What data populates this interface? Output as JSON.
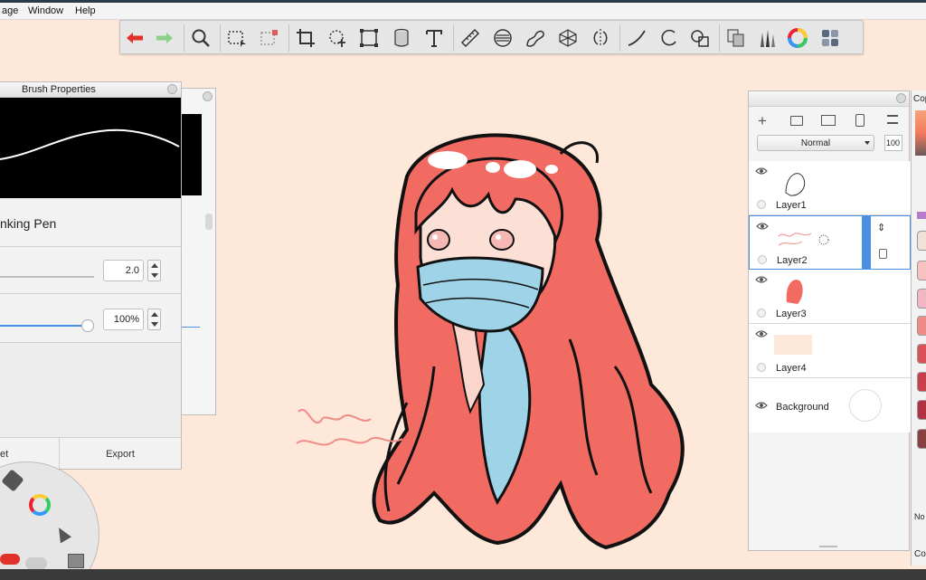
{
  "menu": {
    "items": [
      "age",
      "Window",
      "Help"
    ]
  },
  "toolbar": {
    "tools": [
      "undo-arrow-icon",
      "redo-arrow-icon",
      "magnify-icon",
      "marquee-select-icon",
      "lasso-select-icon",
      "crop-icon",
      "transform-icon",
      "perspective-icon",
      "fill-bucket-icon",
      "text-icon",
      "ruler-icon",
      "ellipse-guide-icon",
      "french-curve-icon",
      "perspective-grid-icon",
      "symmetry-icon",
      "stroke-line-icon",
      "ellipse-icon",
      "shape-icon",
      "layer-copy-icon",
      "brush-library-icon",
      "color-wheel-icon",
      "swatches-icon"
    ]
  },
  "brush_panel": {
    "title": "Brush Properties",
    "brush_name": "nking Pen",
    "size_value": "2.0",
    "opacity_value": "100%",
    "reset_label": "et",
    "export_label": "Export"
  },
  "layers": {
    "blend_mode": "Normal",
    "opacity": "100",
    "rows": [
      {
        "name": "Layer1"
      },
      {
        "name": "Layer2"
      },
      {
        "name": "Layer3"
      },
      {
        "name": "Layer4"
      },
      {
        "name": "Background"
      }
    ]
  },
  "color_panel": {
    "header": "Cop",
    "label_no": "No",
    "label_co": "Co"
  },
  "colors": {
    "accent": "#4a90e2",
    "canvas": "#fde8da",
    "hair": "#f26b63",
    "mask": "#9fd3e8"
  }
}
